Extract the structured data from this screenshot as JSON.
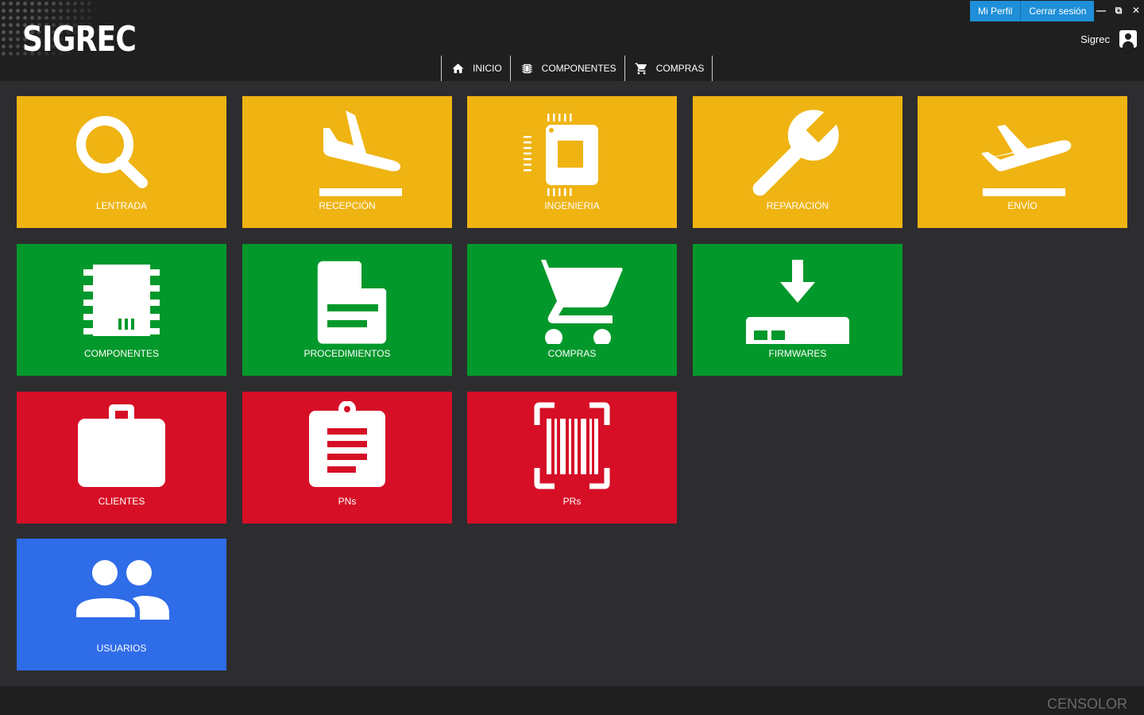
{
  "app": {
    "logo_text": "SIGREC"
  },
  "profile": {
    "my_profile": "Mi Perfil",
    "logout": "Cerrar sesión"
  },
  "window_controls": {
    "minimize": "—",
    "restore": "⧉",
    "close": "✕"
  },
  "user": {
    "name": "Sigrec"
  },
  "nav": {
    "items": [
      {
        "label": "INICIO",
        "icon": "home-icon"
      },
      {
        "label": "COMPONENTES",
        "icon": "chip-icon"
      },
      {
        "label": "COMPRAS",
        "icon": "cart-icon"
      }
    ]
  },
  "tiles": [
    {
      "label": "LENTRADA",
      "icon": "search-icon",
      "color": "#efb312"
    },
    {
      "label": "RECEPCIÓN",
      "icon": "airplane-landing-icon",
      "color": "#efb312"
    },
    {
      "label": "INGENIERIA",
      "icon": "processor-icon",
      "color": "#efb312"
    },
    {
      "label": "REPARACIÓN",
      "icon": "wrench-icon",
      "color": "#efb312"
    },
    {
      "label": "ENVÍO",
      "icon": "airplane-takeoff-icon",
      "color": "#efb312"
    },
    {
      "label": "COMPONENTES",
      "icon": "memory-icon",
      "color": "#03982b"
    },
    {
      "label": "PROCEDIMIENTOS",
      "icon": "document-icon",
      "color": "#03982b"
    },
    {
      "label": "COMPRAS",
      "icon": "cart-icon",
      "color": "#03982b"
    },
    {
      "label": "FIRMWARES",
      "icon": "download-router-icon",
      "color": "#03982b"
    },
    {
      "label": "CLIENTES",
      "icon": "briefcase-icon",
      "color": "#d60f27"
    },
    {
      "label": "PNs",
      "icon": "clipboard-icon",
      "color": "#d60f27"
    },
    {
      "label": "PRs",
      "icon": "barcode-scan-icon",
      "color": "#d60f27"
    },
    {
      "label": "USUARIOS",
      "icon": "users-icon",
      "color": "#2f6ce8"
    }
  ],
  "footer": {
    "brand": "CENSOLOR"
  }
}
